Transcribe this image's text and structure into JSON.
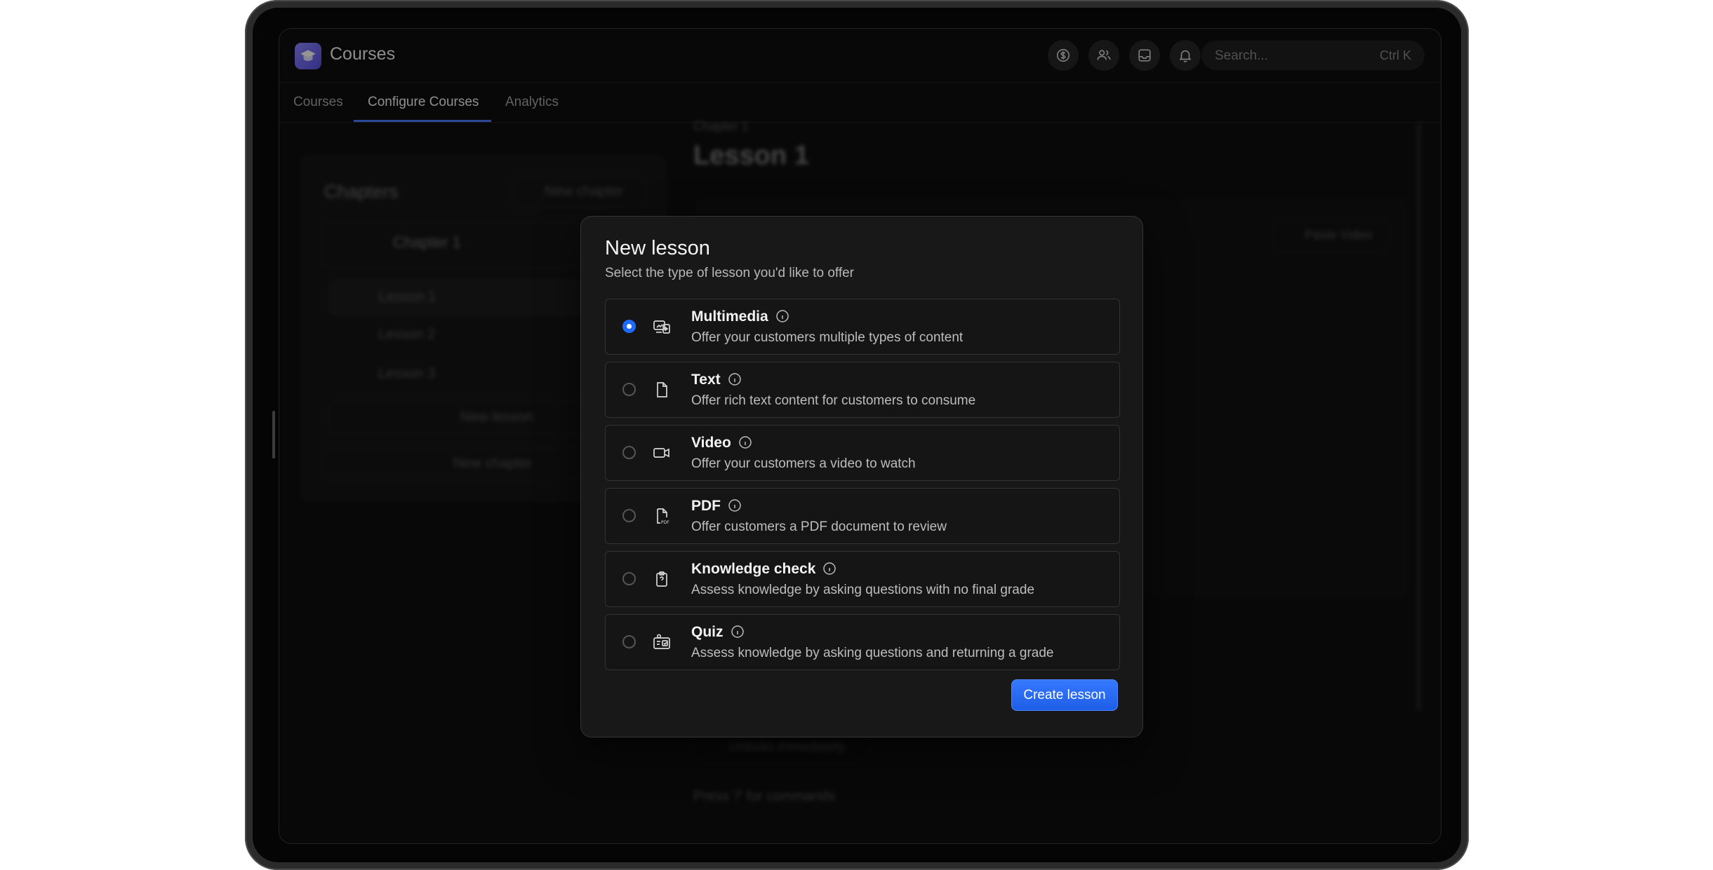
{
  "app": {
    "title": "Courses",
    "search": {
      "placeholder": "Search...",
      "shortcut": "Ctrl K"
    },
    "toolbar_icons": [
      "dollar-icon",
      "users-icon",
      "inbox-icon",
      "bell-icon"
    ]
  },
  "tabs": [
    {
      "label": "Courses",
      "active": false
    },
    {
      "label": "Configure Courses",
      "active": true
    },
    {
      "label": "Analytics",
      "active": false
    }
  ],
  "background": {
    "chapters_title": "Chapters",
    "new_chapter_top": "New chapter",
    "chapter_name": "Chapter 1",
    "lessons": [
      "Lesson 1",
      "Lesson 2",
      "Lesson 3"
    ],
    "new_lesson": "New lesson",
    "new_chapter_bottom": "New chapter",
    "breadcrumb": "Chapter 1",
    "lesson_title": "Lesson 1",
    "paste_video": "Paste Video",
    "unlocks": "Unlocks immediately",
    "commands_hint": "Press '/' for commands"
  },
  "modal": {
    "title": "New lesson",
    "subtitle": "Select the type of lesson you'd like to offer",
    "options": [
      {
        "title": "Multimedia",
        "description": "Offer your customers multiple types of content",
        "icon": "multimedia-icon",
        "selected": true
      },
      {
        "title": "Text",
        "description": "Offer rich text content for customers to consume",
        "icon": "document-icon",
        "selected": false
      },
      {
        "title": "Video",
        "description": "Offer your customers a video to watch",
        "icon": "video-icon",
        "selected": false
      },
      {
        "title": "PDF",
        "description": "Offer customers a PDF document to review",
        "icon": "pdf-icon",
        "selected": false
      },
      {
        "title": "Knowledge check",
        "description": "Assess knowledge by asking questions with no final grade",
        "icon": "clipboard-question-icon",
        "selected": false
      },
      {
        "title": "Quiz",
        "description": "Assess knowledge by asking questions and returning a grade",
        "icon": "quiz-icon",
        "selected": false
      }
    ],
    "create_label": "Create lesson"
  },
  "colors": {
    "accent": "#1f6bff",
    "logo": "#6f66f2"
  }
}
